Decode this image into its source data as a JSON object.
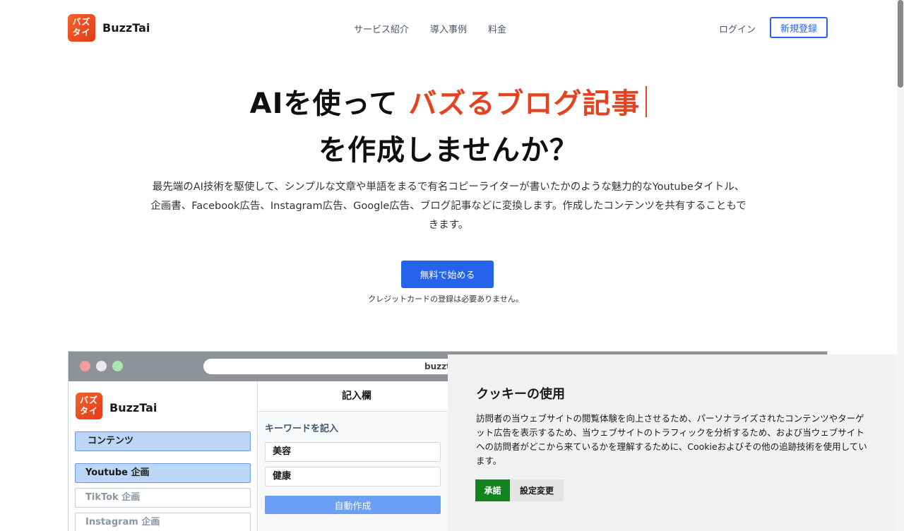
{
  "brand": {
    "badge_line1": "バズ",
    "badge_line2": "タイ",
    "name": "BuzzTai"
  },
  "nav": {
    "items": [
      "サービス紹介",
      "導入事例",
      "料金"
    ],
    "login": "ログイン",
    "signup": "新規登録"
  },
  "hero": {
    "line1_prefix": "AIを使って ",
    "line1_accent": "バズるブログ記事",
    "line2": "を作成しませんか？",
    "description": "最先端のAI技術を駆使して、シンプルな文章や単語をまるで有名コピーライターが書いたかのような魅力的なYoutubeタイトル、企画書、Facebook広告、Instagram広告、Google広告、ブログ記事などに変換します。作成したコンテンツを共有することもできます。",
    "cta_label": "無料で始める",
    "cta_note": "クレジットカードの登録は必要ありません。",
    "accent_color": "#e3431f"
  },
  "mock": {
    "url": "buzzta",
    "sidebar": {
      "items": [
        {
          "label": "コンテンツ",
          "state": "active"
        },
        {
          "label": "Youtube 企画",
          "state": "active"
        },
        {
          "label": "TikTok 企画",
          "state": "inactive"
        },
        {
          "label": "Instagram 企画",
          "state": "inactive"
        }
      ]
    },
    "main": {
      "title": "記入欄",
      "keyword_label": "キーワードを記入",
      "keywords": [
        "美容",
        "健康"
      ],
      "auto_button": "自動作成"
    }
  },
  "cookie": {
    "title": "クッキーの使用",
    "text": "訪問者の当ウェブサイトの閲覧体験を向上させるため、パーソナライズされたコンテンツやターゲット広告を表示するため、当ウェブサイトのトラフィックを分析するため、および当ウェブサイトへの訪問者がどこから来ているかを理解するために、Cookieおよびその他の追跡技術を使用しています。",
    "accept": "承諾",
    "settings": "設定変更"
  },
  "colors": {
    "primary": "#2563eb",
    "accept_green": "#12841f"
  }
}
